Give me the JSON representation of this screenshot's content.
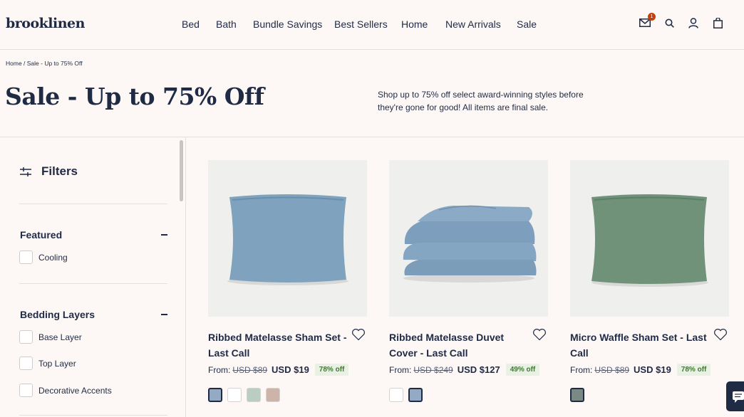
{
  "header": {
    "logo": "brooklinen",
    "nav": [
      "Bed",
      "Bath",
      "Bundle Savings",
      "Best Sellers",
      "Home",
      "New Arrivals",
      "Sale"
    ],
    "icons": [
      "mail-icon",
      "search-icon",
      "account-icon",
      "bag-icon"
    ],
    "mail_badge": "1"
  },
  "breadcrumb": "Home / Sale - Up to 75% Off",
  "hero": {
    "title": "Sale - Up to 75% Off",
    "description": "Shop up to 75% off select award-winning styles before they're gone for good! All items are final sale."
  },
  "sidebar": {
    "filters_label": "Filters",
    "sections": [
      {
        "title": "Featured",
        "options": [
          "Cooling"
        ]
      },
      {
        "title": "Bedding Layers",
        "options": [
          "Base Layer",
          "Top Layer",
          "Decorative Accents"
        ]
      }
    ]
  },
  "products": [
    {
      "name": "Ribbed Matelasse Sham Set - Last Call",
      "from": "From:",
      "old_price": "USD $89",
      "new_price": "USD $19",
      "discount": "78% off",
      "swatches": [
        "#93a9c4",
        "#ffffff",
        "#b9cdc3",
        "#cdb4ab"
      ]
    },
    {
      "name": "Ribbed Matelasse Duvet Cover - Last Call",
      "from": "From:",
      "old_price": "USD $249",
      "new_price": "USD $127",
      "discount": "49% off",
      "swatches": [
        "#ffffff",
        "#93a9c4"
      ]
    },
    {
      "name": "Micro Waffle Sham Set - Last Call",
      "from": "From:",
      "old_price": "USD $89",
      "new_price": "USD $19",
      "discount": "78% off",
      "swatches": [
        "#7a8a82"
      ]
    }
  ],
  "colors": {
    "navy": "#1f2a44",
    "background": "#fdf8f6",
    "discount_green": "#3e7a2a",
    "badge": "#c2410c"
  }
}
